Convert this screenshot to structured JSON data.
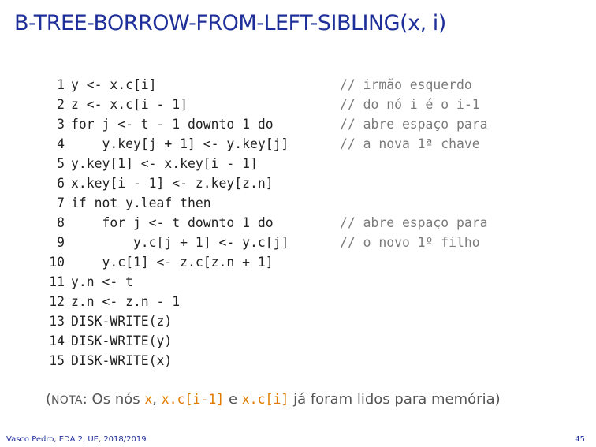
{
  "title": "B-TREE-BORROW-FROM-LEFT-SIBLING(x, i)",
  "code": [
    {
      "n": "1",
      "text": "y <- x.c[i]",
      "comment": "// irmão esquerdo"
    },
    {
      "n": "2",
      "text": "z <- x.c[i - 1]",
      "comment": "// do nó i é o i-1"
    },
    {
      "n": "3",
      "text": "for j <- t - 1 downto 1 do",
      "comment": "// abre espaço para"
    },
    {
      "n": "4",
      "text": "    y.key[j + 1] <- y.key[j]",
      "comment": "// a nova 1ª chave"
    },
    {
      "n": "5",
      "text": "y.key[1] <- x.key[i - 1]",
      "comment": ""
    },
    {
      "n": "6",
      "text": "x.key[i - 1] <- z.key[z.n]",
      "comment": ""
    },
    {
      "n": "7",
      "text": "if not y.leaf then",
      "comment": ""
    },
    {
      "n": "8",
      "text": "    for j <- t downto 1 do",
      "comment": "// abre espaço para"
    },
    {
      "n": "9",
      "text": "        y.c[j + 1] <- y.c[j]",
      "comment": "// o novo 1º filho"
    },
    {
      "n": "10",
      "text": "    y.c[1] <- z.c[z.n + 1]",
      "comment": ""
    },
    {
      "n": "11",
      "text": "y.n <- t",
      "comment": ""
    },
    {
      "n": "12",
      "text": "z.n <- z.n - 1",
      "comment": ""
    },
    {
      "n": "13",
      "text": "DISK-WRITE(z)",
      "comment": ""
    },
    {
      "n": "14",
      "text": "DISK-WRITE(y)",
      "comment": ""
    },
    {
      "n": "15",
      "text": "DISK-WRITE(x)",
      "comment": ""
    }
  ],
  "note": {
    "open": "(",
    "label": "NOTA",
    "after_label": ": Os nós ",
    "v1": "x",
    "sep1": ", ",
    "v2": "x.c[i-1]",
    "sep2": " e ",
    "v3": "x.c[i]",
    "tail": " já foram lidos para memória)"
  },
  "footer": "Vasco Pedro, EDA 2, UE, 2018/2019",
  "page_number": "45"
}
